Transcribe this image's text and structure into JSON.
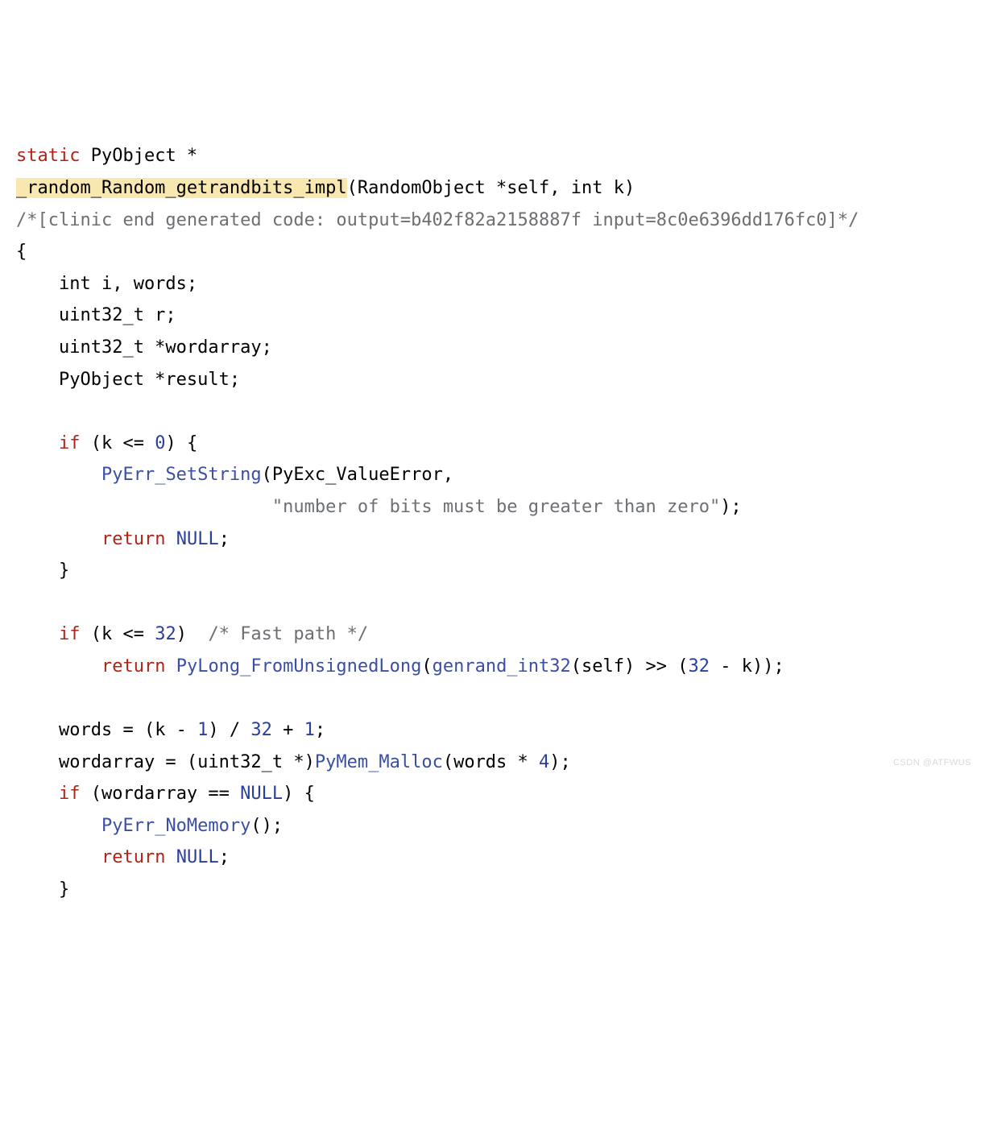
{
  "code": {
    "l1": {
      "kw_static": "static",
      "rest": " PyObject *"
    },
    "l2": {
      "fn_hl": "_random_Random_getrandbits_impl",
      "rest": "(RandomObject *self, int k)"
    },
    "l3": {
      "comment": "/*[clinic end generated code: output=b402f82a2158887f input=8c0e6396dd176fc0]*/"
    },
    "l4": {
      "text": "{"
    },
    "l5": {
      "text": "    int i, words;"
    },
    "l6": {
      "text": "    uint32_t r;"
    },
    "l7": {
      "text": "    uint32_t *wordarray;"
    },
    "l8": {
      "text": "    PyObject *result;"
    },
    "l9": {
      "text": ""
    },
    "l10": {
      "indent": "    ",
      "kw_if": "if",
      "rest1": " (k <= ",
      "num0": "0",
      "rest2": ") {"
    },
    "l11": {
      "indent": "        ",
      "fn": "PyErr_SetString",
      "rest": "(PyExc_ValueError,"
    },
    "l12": {
      "indent": "                        ",
      "str": "\"number of bits must be greater than zero\"",
      "rest": ");"
    },
    "l13": {
      "indent": "        ",
      "kw_return": "return",
      "sp": " ",
      "null": "NULL",
      "rest": ";"
    },
    "l14": {
      "text": "    }"
    },
    "l15": {
      "text": ""
    },
    "l16": {
      "indent": "    ",
      "kw_if": "if",
      "rest1": " (k <= ",
      "num": "32",
      "rest2": ")  ",
      "comment": "/* Fast path */"
    },
    "l17": {
      "indent": "        ",
      "kw_return": "return",
      "sp": " ",
      "fn": "PyLong_FromUnsignedLong",
      "op": "(",
      "fn2": "genrand_int32",
      "mid": "(self) >> (",
      "num": "32",
      "rest": " - k));"
    },
    "l18": {
      "text": ""
    },
    "l19": {
      "indent": "    ",
      "a": "words = (k - ",
      "n1": "1",
      "b": ") / ",
      "n2": "32",
      "c": " + ",
      "n3": "1",
      "d": ";"
    },
    "l20": {
      "indent": "    ",
      "a": "wordarray = (uint32_t *)",
      "fn": "PyMem_Malloc",
      "b": "(words * ",
      "n1": "4",
      "c": ");"
    },
    "l21": {
      "indent": "    ",
      "kw_if": "if",
      "a": " (wordarray == ",
      "null": "NULL",
      "b": ") {"
    },
    "l22": {
      "indent": "        ",
      "fn": "PyErr_NoMemory",
      "rest": "();"
    },
    "l23": {
      "indent": "        ",
      "kw_return": "return",
      "sp": " ",
      "null": "NULL",
      "rest": ";"
    },
    "l24": {
      "text": "    }"
    }
  },
  "watermark": "CSDN @ATFWUS"
}
